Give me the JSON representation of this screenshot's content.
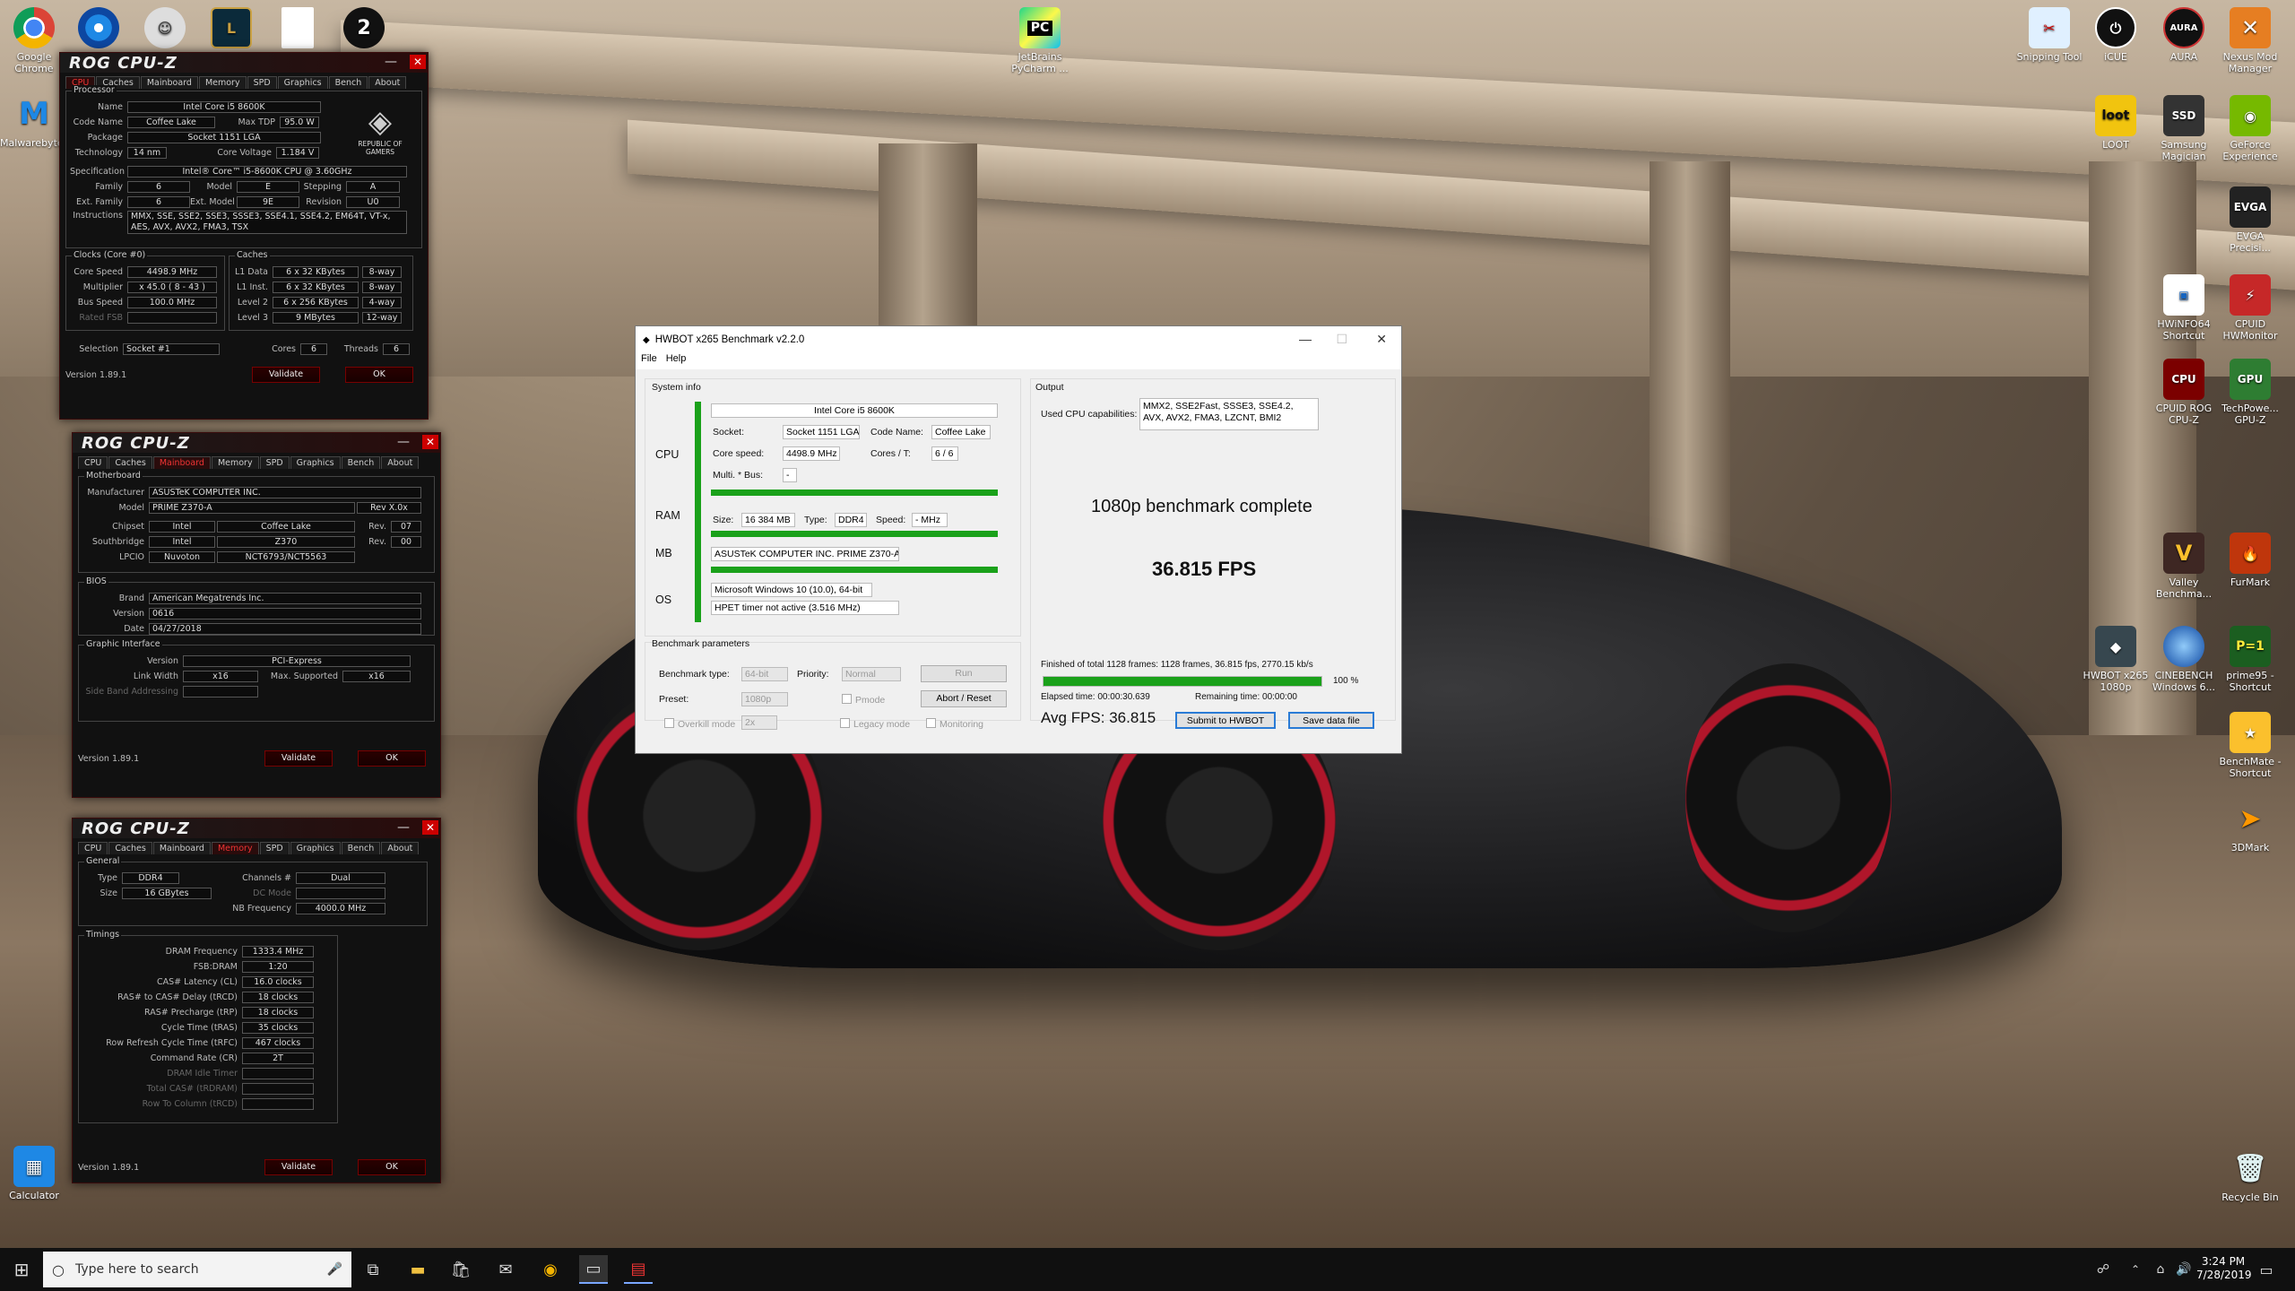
{
  "desktop_left_icons": [
    {
      "label": "Google Chrome",
      "icon": "chrome-icon"
    },
    {
      "label": "",
      "icon": "app-swirl-icon"
    },
    {
      "label": "",
      "icon": "app-helmet-icon"
    },
    {
      "label": "",
      "icon": "league-icon"
    },
    {
      "label": "",
      "icon": "document-icon"
    },
    {
      "label": "",
      "icon": "app-2-icon"
    },
    {
      "label": "Malwarebytes",
      "icon": "malwarebytes-icon"
    },
    {
      "label": "Calculator",
      "icon": "calculator-icon"
    }
  ],
  "desktop_right_icons": [
    {
      "label": "Snipping Tool",
      "icon": "snipping-icon"
    },
    {
      "label": "iCUE",
      "icon": "icue-icon"
    },
    {
      "label": "AURA",
      "icon": "aura-icon"
    },
    {
      "label": "Nexus Mod Manager",
      "icon": "nexus-icon"
    },
    {
      "label": "LOOT",
      "icon": "loot-icon"
    },
    {
      "label": "Samsung Magician",
      "icon": "samsung-icon"
    },
    {
      "label": "GeForce Experience",
      "icon": "geforce-icon"
    },
    {
      "label": "EVGA Precisi...",
      "icon": "evga-icon"
    },
    {
      "label": "HWiNFO64 Shortcut",
      "icon": "hwinfo-icon"
    },
    {
      "label": "CPUID HWMonitor",
      "icon": "hwmonitor-icon"
    },
    {
      "label": "CPUID ROG CPU-Z",
      "icon": "cpuz-icon"
    },
    {
      "label": "TechPowe... GPU-Z",
      "icon": "gpuz-icon"
    },
    {
      "label": "Valley Benchma...",
      "icon": "valley-icon"
    },
    {
      "label": "FurMark",
      "icon": "furmark-icon"
    },
    {
      "label": "HWBOT x265 1080p",
      "icon": "hwbot-icon"
    },
    {
      "label": "CINEBENCH Windows 6...",
      "icon": "cinebench-icon"
    },
    {
      "label": "prime95 - Shortcut",
      "icon": "prime95-icon"
    },
    {
      "label": "BenchMate - Shortcut",
      "icon": "benchmate-icon"
    },
    {
      "label": "3DMark",
      "icon": "3dmark-icon"
    },
    {
      "label": "Recycle Bin",
      "icon": "recycle-bin-icon"
    }
  ],
  "pycharm": {
    "label": "JetBrains PyCharm ..."
  },
  "cpuz_cpu": {
    "logo": "ROG CPU-Z",
    "tabs": [
      "CPU",
      "Caches",
      "Mainboard",
      "Memory",
      "SPD",
      "Graphics",
      "Bench",
      "About"
    ],
    "processor_title": "Processor",
    "name_label": "Name",
    "name": "Intel Core i5 8600K",
    "codename_label": "Code Name",
    "codename": "Coffee Lake",
    "maxtdp_label": "Max TDP",
    "maxtdp": "95.0 W",
    "package_label": "Package",
    "package": "Socket 1151 LGA",
    "tech_label": "Technology",
    "tech": "14 nm",
    "corevolt_label": "Core Voltage",
    "corevolt": "1.184 V",
    "spec_label": "Specification",
    "spec": "Intel® Core™ i5-8600K CPU @ 3.60GHz",
    "family_label": "Family",
    "family": "6",
    "model_label": "Model",
    "model": "E",
    "stepping_label": "Stepping",
    "stepping": "A",
    "extfamily_label": "Ext. Family",
    "extfamily": "6",
    "extmodel_label": "Ext. Model",
    "extmodel": "9E",
    "revision_label": "Revision",
    "revision": "U0",
    "instr_label": "Instructions",
    "instr": "MMX, SSE, SSE2, SSE3, SSSE3, SSE4.1, SSE4.2, EM64T, VT-x, AES, AVX, AVX2, FMA3, TSX",
    "rog_text": "REPUBLIC OF GAMERS",
    "clocks_title": "Clocks (Core #0)",
    "corespeed_label": "Core Speed",
    "corespeed": "4498.9 MHz",
    "mult_label": "Multiplier",
    "mult": "x 45.0 ( 8 - 43 )",
    "bus_label": "Bus Speed",
    "bus": "100.0 MHz",
    "ratedfsb_label": "Rated FSB",
    "caches_title": "Caches",
    "l1d_label": "L1 Data",
    "l1d": "6 x 32 KBytes",
    "l1d_way": "8-way",
    "l1i_label": "L1 Inst.",
    "l1i": "6 x 32 KBytes",
    "l1i_way": "8-way",
    "l2_label": "Level 2",
    "l2": "6 x 256 KBytes",
    "l2_way": "4-way",
    "l3_label": "Level 3",
    "l3": "9 MBytes",
    "l3_way": "12-way",
    "selection_label": "Selection",
    "selection": "Socket #1",
    "cores_label": "Cores",
    "cores": "6",
    "threads_label": "Threads",
    "threads": "6",
    "version": "Version 1.89.1",
    "validate": "Validate",
    "ok": "OK"
  },
  "cpuz_mb": {
    "logo": "ROG CPU-Z",
    "tabs": [
      "CPU",
      "Caches",
      "Mainboard",
      "Memory",
      "SPD",
      "Graphics",
      "Bench",
      "About"
    ],
    "mb_title": "Motherboard",
    "manu_label": "Manufacturer",
    "manu": "ASUSTeK COMPUTER INC.",
    "model_label": "Model",
    "model": "PRIME Z370-A",
    "model_rev": "Rev X.0x",
    "chipset_label": "Chipset",
    "chipset_v": "Intel",
    "chipset_n": "Coffee Lake",
    "rev_label": "Rev.",
    "chipset_rev": "07",
    "south_label": "Southbridge",
    "south_v": "Intel",
    "south_n": "Z370",
    "south_rev": "00",
    "lpcio_label": "LPCIO",
    "lpcio_v": "Nuvoton",
    "lpcio_n": "NCT6793/NCT5563",
    "bios_title": "BIOS",
    "brand_label": "Brand",
    "brand": "American Megatrends Inc.",
    "ver_label": "Version",
    "ver": "0616",
    "date_label": "Date",
    "date": "04/27/2018",
    "gi_title": "Graphic Interface",
    "gi_ver_label": "Version",
    "gi_ver": "PCI-Express",
    "lw_label": "Link Width",
    "lw": "x16",
    "ms_label": "Max. Supported",
    "ms": "x16",
    "sba_label": "Side Band Addressing",
    "version": "Version 1.89.1",
    "validate": "Validate",
    "ok": "OK"
  },
  "cpuz_mem": {
    "logo": "ROG CPU-Z",
    "tabs": [
      "CPU",
      "Caches",
      "Mainboard",
      "Memory",
      "SPD",
      "Graphics",
      "Bench",
      "About"
    ],
    "gen_title": "General",
    "type_label": "Type",
    "type": "DDR4",
    "channels_label": "Channels #",
    "channels": "Dual",
    "size_label": "Size",
    "size": "16 GBytes",
    "dcmode_label": "DC Mode",
    "nbfreq_label": "NB Frequency",
    "nbfreq": "4000.0 MHz",
    "tim_title": "Timings",
    "timings": [
      {
        "label": "DRAM Frequency",
        "value": "1333.4 MHz"
      },
      {
        "label": "FSB:DRAM",
        "value": "1:20"
      },
      {
        "label": "CAS# Latency (CL)",
        "value": "16.0 clocks"
      },
      {
        "label": "RAS# to CAS# Delay (tRCD)",
        "value": "18 clocks"
      },
      {
        "label": "RAS# Precharge (tRP)",
        "value": "18 clocks"
      },
      {
        "label": "Cycle Time (tRAS)",
        "value": "35 clocks"
      },
      {
        "label": "Row Refresh Cycle Time (tRFC)",
        "value": "467 clocks"
      },
      {
        "label": "Command Rate (CR)",
        "value": "2T"
      },
      {
        "label": "DRAM Idle Timer",
        "value": ""
      },
      {
        "label": "Total CAS# (tRDRAM)",
        "value": ""
      },
      {
        "label": "Row To Column (tRCD)",
        "value": ""
      }
    ],
    "version": "Version 1.89.1",
    "validate": "Validate",
    "ok": "OK"
  },
  "hwbot": {
    "title": "HWBOT x265 Benchmark v2.2.0",
    "menu_file": "File",
    "menu_help": "Help",
    "sysinfo": "System info",
    "cpu_name": "Intel Core i5 8600K",
    "cpu_label": "CPU",
    "ram_label": "RAM",
    "mb_label": "MB",
    "os_label": "OS",
    "socket_label": "Socket:",
    "socket": "Socket 1151 LGA",
    "codename_label": "Code Name:",
    "codename": "Coffee Lake",
    "corespeed_label": "Core speed:",
    "corespeed": "4498.9 MHz",
    "corest_label": "Cores / T:",
    "corest": "6 / 6",
    "multbus_label": "Multi. * Bus:",
    "multbus": "-",
    "size_label": "Size:",
    "size": "16 384 MB",
    "type_label": "Type:",
    "type": "DDR4",
    "speed_label": "Speed:",
    "speed": "- MHz",
    "mb": "ASUSTeK COMPUTER INC. PRIME Z370-A",
    "os": "Microsoft Windows 10 (10.0), 64-bit",
    "hpet": "HPET timer not active (3.516 MHz)",
    "params": "Benchmark parameters",
    "btype_label": "Benchmark type:",
    "btype": "64-bit",
    "priority_label": "Priority:",
    "priority": "Normal",
    "run": "Run",
    "preset_label": "Preset:",
    "preset": "1080p",
    "pmode": "Pmode",
    "abort": "Abort / Reset",
    "overkill": "Overkill mode",
    "overkill_val": "2x",
    "legacy": "Legacy mode",
    "monitoring": "Monitoring",
    "output": "Output",
    "caps_label": "Used CPU capabilities:",
    "caps": "MMX2, SSE2Fast, SSSE3, SSE4.2, AVX, AVX2, FMA3, LZCNT, BMI2",
    "complete": "1080p benchmark complete",
    "fps": "36.815 FPS",
    "finished": "Finished of total 1128 frames: 1128 frames, 36.815 fps,  2770.15 kb/s",
    "progress": 100,
    "progress_text": "100 %",
    "elapsed": "Elapsed time: 00:00:30.639",
    "remaining": "Remaining time: 00:00:00",
    "avg": "Avg FPS: 36.815",
    "submit": "Submit to HWBOT",
    "save": "Save data file"
  },
  "taskbar": {
    "search_placeholder": "Type here to search",
    "time": "3:24 PM",
    "date": "7/28/2019"
  }
}
